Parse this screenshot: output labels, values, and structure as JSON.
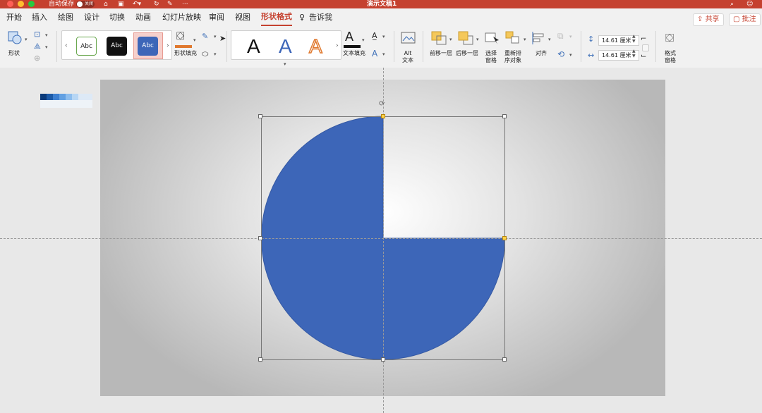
{
  "window": {
    "title": "演示文稿1",
    "autosave_label": "自动保存",
    "autosave_state": "关闭"
  },
  "tabs": [
    {
      "label": "开始"
    },
    {
      "label": "插入"
    },
    {
      "label": "绘图"
    },
    {
      "label": "设计"
    },
    {
      "label": "切换"
    },
    {
      "label": "动画"
    },
    {
      "label": "幻灯片放映"
    },
    {
      "label": "审阅"
    },
    {
      "label": "视图"
    },
    {
      "label": "形状格式",
      "active": true
    },
    {
      "label": "告诉我"
    }
  ],
  "share_label": "共享",
  "comment_label": "批注",
  "ribbon": {
    "shape_label": "形状",
    "style_samples": [
      "Abc",
      "Abc",
      "Abc"
    ],
    "shape_fill_label": "形状填充",
    "wordart_letter": "A",
    "text_fill_label": "文本填充",
    "alt_text_label": "Alt\n文本",
    "bring_forward_label": "前移一层",
    "send_backward_label": "后移一层",
    "selection_pane_label": "选择\n窗格",
    "reorder_label": "重新排\n序对象",
    "align_label": "对齐",
    "height_value": "14.61 厘米",
    "width_value": "14.61 厘米",
    "format_pane_label": "格式\n窗格"
  },
  "colors": {
    "titlebar": "#c5412f",
    "accent": "#c5412f",
    "shape_fill": "#3d66b8",
    "fill_bar": "#e0792f"
  }
}
